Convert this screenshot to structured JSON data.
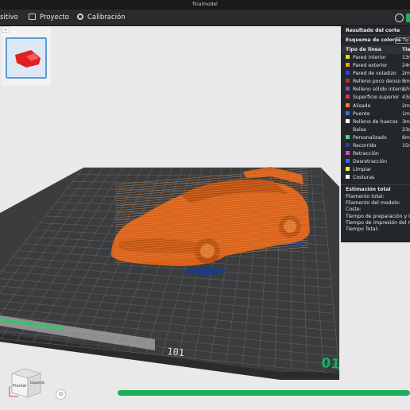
{
  "window": {
    "title": "finalmodel"
  },
  "menubar": {
    "items": [
      {
        "label": "sitivo",
        "icon": "monitor-icon"
      },
      {
        "label": "Proyecto",
        "icon": "project-icon"
      },
      {
        "label": "Calibración",
        "icon": "calibration-icon"
      }
    ]
  },
  "thumbnail": {
    "collapse_label": "‹›"
  },
  "slice_panel": {
    "title": "Resultado del corte",
    "scheme_label": "Esquema de colores",
    "scheme_value": "Tip",
    "col_type": "Tipo de línea",
    "col_time": "Tien",
    "lines": [
      {
        "label": "Pared interior",
        "value": "13m",
        "color": "#f5d90a"
      },
      {
        "label": "Pared exterior",
        "value": "24m",
        "color": "#f39a22"
      },
      {
        "label": "Pared de voladizo",
        "value": "2m",
        "color": "#2b3ff2"
      },
      {
        "label": "Relleno poco denso",
        "value": "8m",
        "color": "#b2313f"
      },
      {
        "label": "Relleno sólido interno",
        "value": "17m",
        "color": "#a33ec9"
      },
      {
        "label": "Superficie superior",
        "value": "43s",
        "color": "#e8304a"
      },
      {
        "label": "Alisado",
        "value": "2m",
        "color": "#e87d2c"
      },
      {
        "label": "Puente",
        "value": "1m",
        "color": "#3f6fc9"
      },
      {
        "label": "Relleno de huecos",
        "value": "3m",
        "color": "#ffffff"
      },
      {
        "label": "Balsa",
        "value": "23s",
        "color": "#1f2326"
      },
      {
        "label": "Personalizado",
        "value": "6m",
        "color": "#4fd18a"
      },
      {
        "label": "Recorrido",
        "value": "15m",
        "color": "#3a3a8c"
      },
      {
        "label": "Retracción",
        "value": "",
        "color": "#d844c8"
      },
      {
        "label": "Desretracción",
        "value": "",
        "color": "#3e66e0"
      },
      {
        "label": "Limpiar",
        "value": "",
        "color": "#f2ef3a"
      },
      {
        "label": "Costuras",
        "value": "",
        "color": "#f2f2f2"
      }
    ],
    "estimate_title": "Estimación total",
    "estimate_rows": [
      "Filamento total:",
      "Filamento del modelo:",
      "Coste:",
      "Tiempo de preparación y lap",
      "Tiempo de impresión del mod",
      "Tiempo Total:"
    ]
  },
  "plate": {
    "number": "01",
    "bed_label": "101"
  },
  "view_cube": {
    "front": "Frontal",
    "side": "Izquierdo"
  },
  "progress": {
    "value": 1.0,
    "color": "#1ab05a"
  }
}
